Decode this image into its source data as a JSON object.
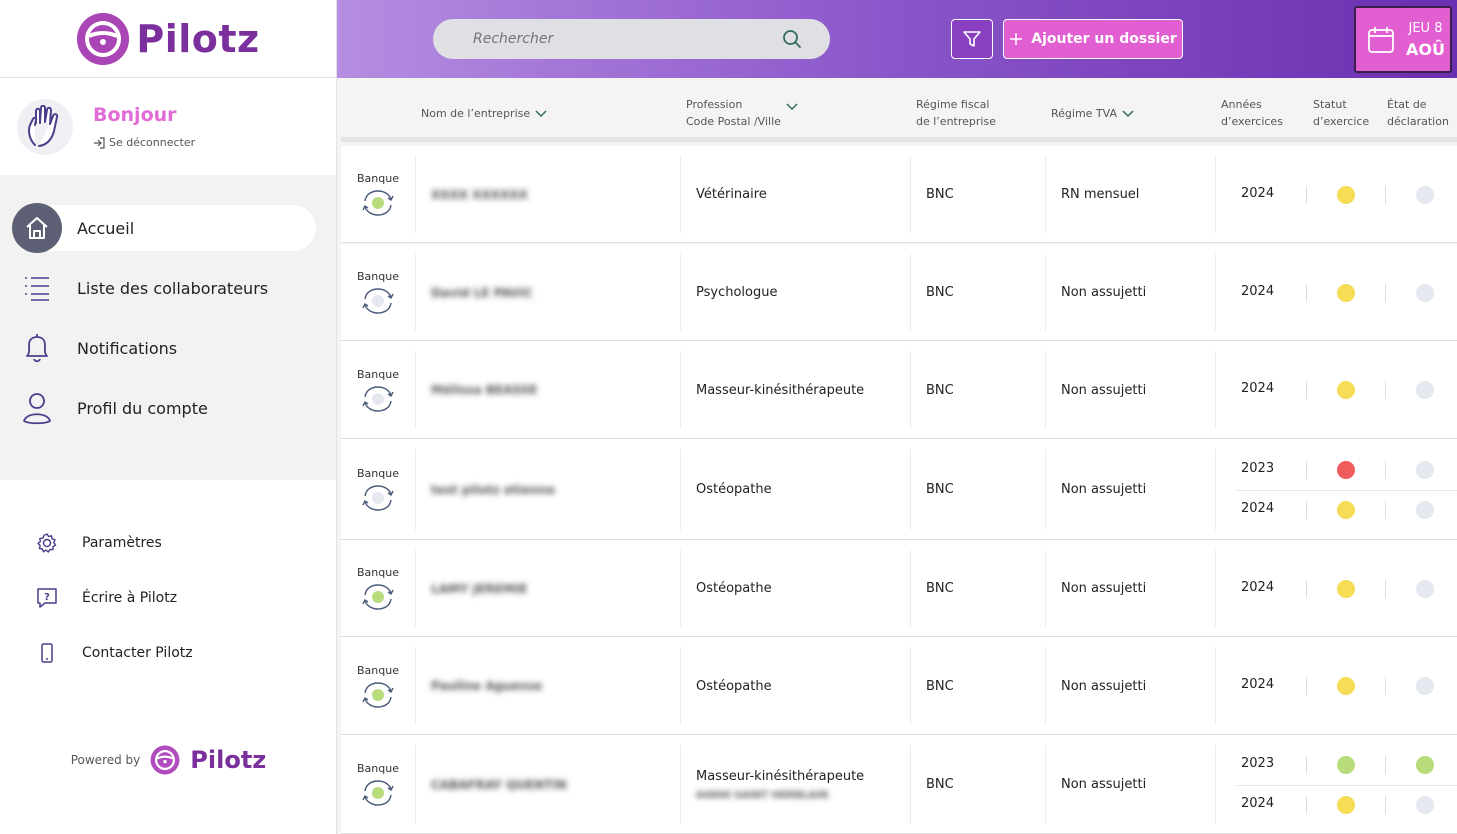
{
  "brand": {
    "name": "Pilotz"
  },
  "sidebar": {
    "greeting": "Bonjour",
    "logout": "Se déconnecter",
    "nav": [
      {
        "label": "Accueil",
        "icon": "home-icon",
        "active": true
      },
      {
        "label": "Liste des collaborateurs",
        "icon": "list-icon",
        "active": false
      },
      {
        "label": "Notifications",
        "icon": "bell-icon",
        "active": false
      },
      {
        "label": "Profil du compte",
        "icon": "user-icon",
        "active": false
      }
    ],
    "secondary": [
      {
        "label": "Paramètres",
        "icon": "gear-icon"
      },
      {
        "label": "Écrire à Pilotz",
        "icon": "message-question-icon"
      },
      {
        "label": "Contacter Pilotz",
        "icon": "phone-icon"
      }
    ],
    "powered_by": "Powered by",
    "powered_name": "Pilotz"
  },
  "header": {
    "search_placeholder": "Rechercher",
    "add_label": "Ajouter un dossier",
    "date_line1": "JEU 8",
    "date_line2": "AOÛ"
  },
  "colors": {
    "accent": "#e25fd2",
    "brand": "#7a2f9c",
    "yellow": "#f7dc55",
    "red": "#f05b5b",
    "green": "#b8dc7c",
    "grey": "#e5e8ee"
  },
  "table": {
    "headers": {
      "company": "Nom de l’entreprise",
      "profession_1": "Profession",
      "profession_2": "Code Postal /Ville",
      "fiscal_1": "Régime fiscal",
      "fiscal_2": "de l’entreprise",
      "tva": "Régime TVA",
      "years_1": "Années",
      "years_2": "d’exercices",
      "status_1": "Statut",
      "status_2": "d’exercice",
      "decl_1": "État de",
      "decl_2": "déclaration"
    },
    "bank_label": "Banque",
    "rows": [
      {
        "name": "XXXX XXXXXX",
        "profession": "Vétérinaire",
        "sub": "",
        "fiscal": "BNC",
        "tva": "RN mensuel",
        "bank_status": "green",
        "years": [
          {
            "year": "2024",
            "status": "yellow",
            "decl": "grey"
          }
        ]
      },
      {
        "name": "David LE PAVIC",
        "profession": "Psychologue",
        "sub": "",
        "fiscal": "BNC",
        "tva": "Non assujetti",
        "bank_status": "grey",
        "years": [
          {
            "year": "2024",
            "status": "yellow",
            "decl": "grey"
          }
        ]
      },
      {
        "name": "Mélissa BEASSE",
        "profession": "Masseur-kinésithérapeute",
        "sub": "",
        "fiscal": "BNC",
        "tva": "Non assujetti",
        "bank_status": "grey",
        "years": [
          {
            "year": "2024",
            "status": "yellow",
            "decl": "grey"
          }
        ]
      },
      {
        "name": "test pilotz etienne",
        "profession": "Ostéopathe",
        "sub": "",
        "fiscal": "BNC",
        "tva": "Non assujetti",
        "bank_status": "grey",
        "years": [
          {
            "year": "2023",
            "status": "red",
            "decl": "grey"
          },
          {
            "year": "2024",
            "status": "yellow",
            "decl": "grey"
          }
        ]
      },
      {
        "name": "LAMY JEREMIE",
        "profession": "Ostéopathe",
        "sub": "",
        "fiscal": "BNC",
        "tva": "Non assujetti",
        "bank_status": "green",
        "years": [
          {
            "year": "2024",
            "status": "yellow",
            "decl": "grey"
          }
        ]
      },
      {
        "name": "Pauline Aguesse",
        "profession": "Ostéopathe",
        "sub": "",
        "fiscal": "BNC",
        "tva": "Non assujetti",
        "bank_status": "green",
        "years": [
          {
            "year": "2024",
            "status": "yellow",
            "decl": "grey"
          }
        ]
      },
      {
        "name": "CABAFRAY QUENTIN",
        "profession": "Masseur-kinésithérapeute",
        "sub": "64800 SAINT HERBLAIN",
        "fiscal": "BNC",
        "tva": "Non assujetti",
        "bank_status": "green",
        "years": [
          {
            "year": "2023",
            "status": "green",
            "decl": "green"
          },
          {
            "year": "2024",
            "status": "yellow",
            "decl": "grey"
          }
        ]
      }
    ]
  }
}
